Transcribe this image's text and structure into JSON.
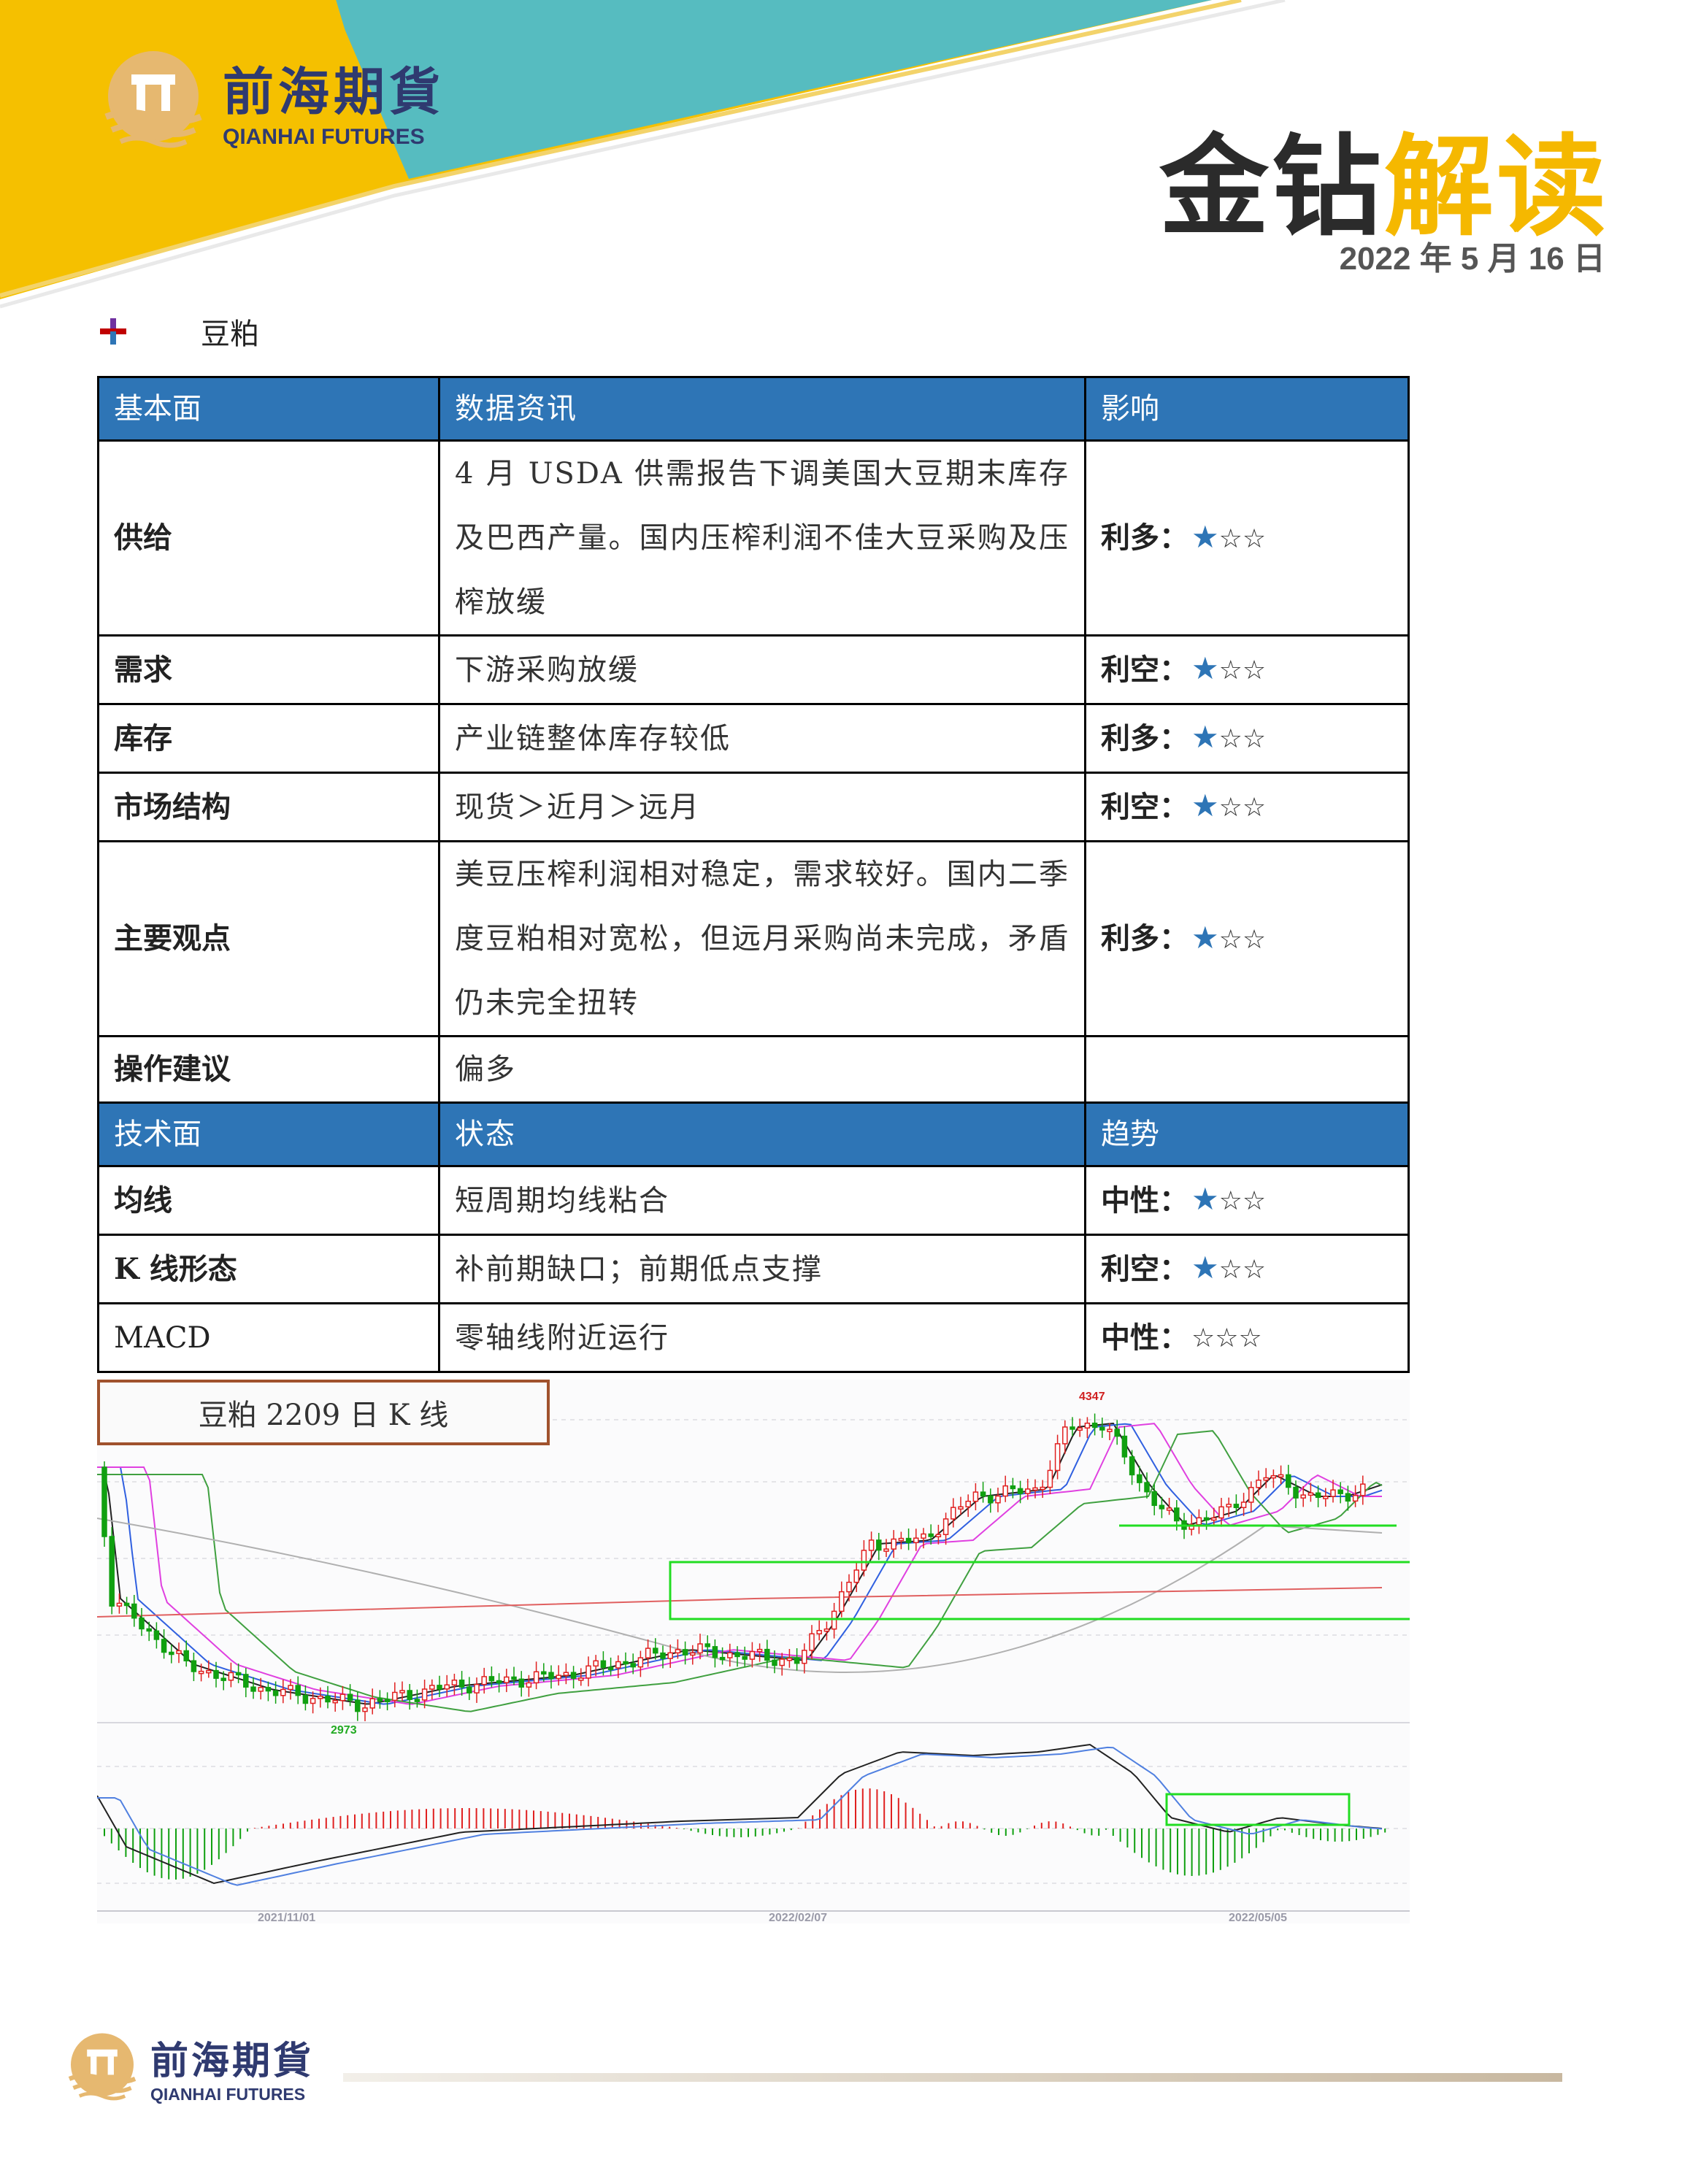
{
  "header": {
    "logo_cn": "前海期貨",
    "logo_en": "QIANHAI FUTURES",
    "brand_part1": "金钻",
    "brand_part2": "解读",
    "date": "2022 年 5 月 16 日",
    "colors": {
      "yellow": "#f5c000",
      "teal": "#56bcc0",
      "navy": "#2f3a70",
      "blue": "#2e75b6"
    }
  },
  "section": {
    "bullet_icon": "cross-bullet-icon",
    "title": "豆粕"
  },
  "table": {
    "fundamental_header": [
      "基本面",
      "数据资讯",
      "影响"
    ],
    "fundamental_rows": [
      {
        "factor": "供给",
        "info": "4 月 USDA 供需报告下调美国大豆期末库存及巴西产量。国内压榨利润不佳大豆采购及压榨放缓",
        "impact": "利多：",
        "stars_filled": 1
      },
      {
        "factor": "需求",
        "info": "下游采购放缓",
        "impact": "利空：",
        "stars_filled": 1
      },
      {
        "factor": "库存",
        "info": "产业链整体库存较低",
        "impact": "利多：",
        "stars_filled": 1
      },
      {
        "factor": "市场结构",
        "info": "现货＞近月＞远月",
        "impact": "利空：",
        "stars_filled": 1
      },
      {
        "factor": "主要观点",
        "info": "美豆压榨利润相对稳定，需求较好。国内二季度豆粕相对宽松，但远月采购尚未完成，矛盾仍未完全扭转",
        "impact": "利多：",
        "stars_filled": 1
      },
      {
        "factor": "操作建议",
        "info": "偏多",
        "impact": "",
        "stars_filled": 0
      }
    ],
    "technical_header": [
      "技术面",
      "状态",
      "趋势"
    ],
    "technical_rows": [
      {
        "factor": "均线",
        "info": "短周期均线粘合",
        "impact": "中性：",
        "stars_filled": 1
      },
      {
        "factor": "K 线形态",
        "info": "补前期缺口；前期低点支撑",
        "impact": "利空：",
        "stars_filled": 1
      },
      {
        "factor": "MACD",
        "info": "零轴线附近运行",
        "impact": "中性：",
        "stars_filled": 0
      }
    ],
    "star_filled": "★",
    "star_empty": "☆"
  },
  "chart": {
    "label": "豆粕 2209 日 K 线",
    "high_label": "4347",
    "low_label": "2973",
    "date_ticks": [
      "2021/11/01",
      "2022/02/07",
      "2022/05/05"
    ]
  },
  "chart_data": {
    "type": "candlestick",
    "title": "豆粕 2209 日 K 线",
    "x": [
      "2021/11/01",
      "2022/02/07",
      "2022/05/05"
    ],
    "annotations": {
      "high": 4347,
      "low": 2973
    },
    "indicator": "MACD"
  },
  "footer": {
    "logo_cn": "前海期貨",
    "logo_en": "QIANHAI FUTURES"
  }
}
